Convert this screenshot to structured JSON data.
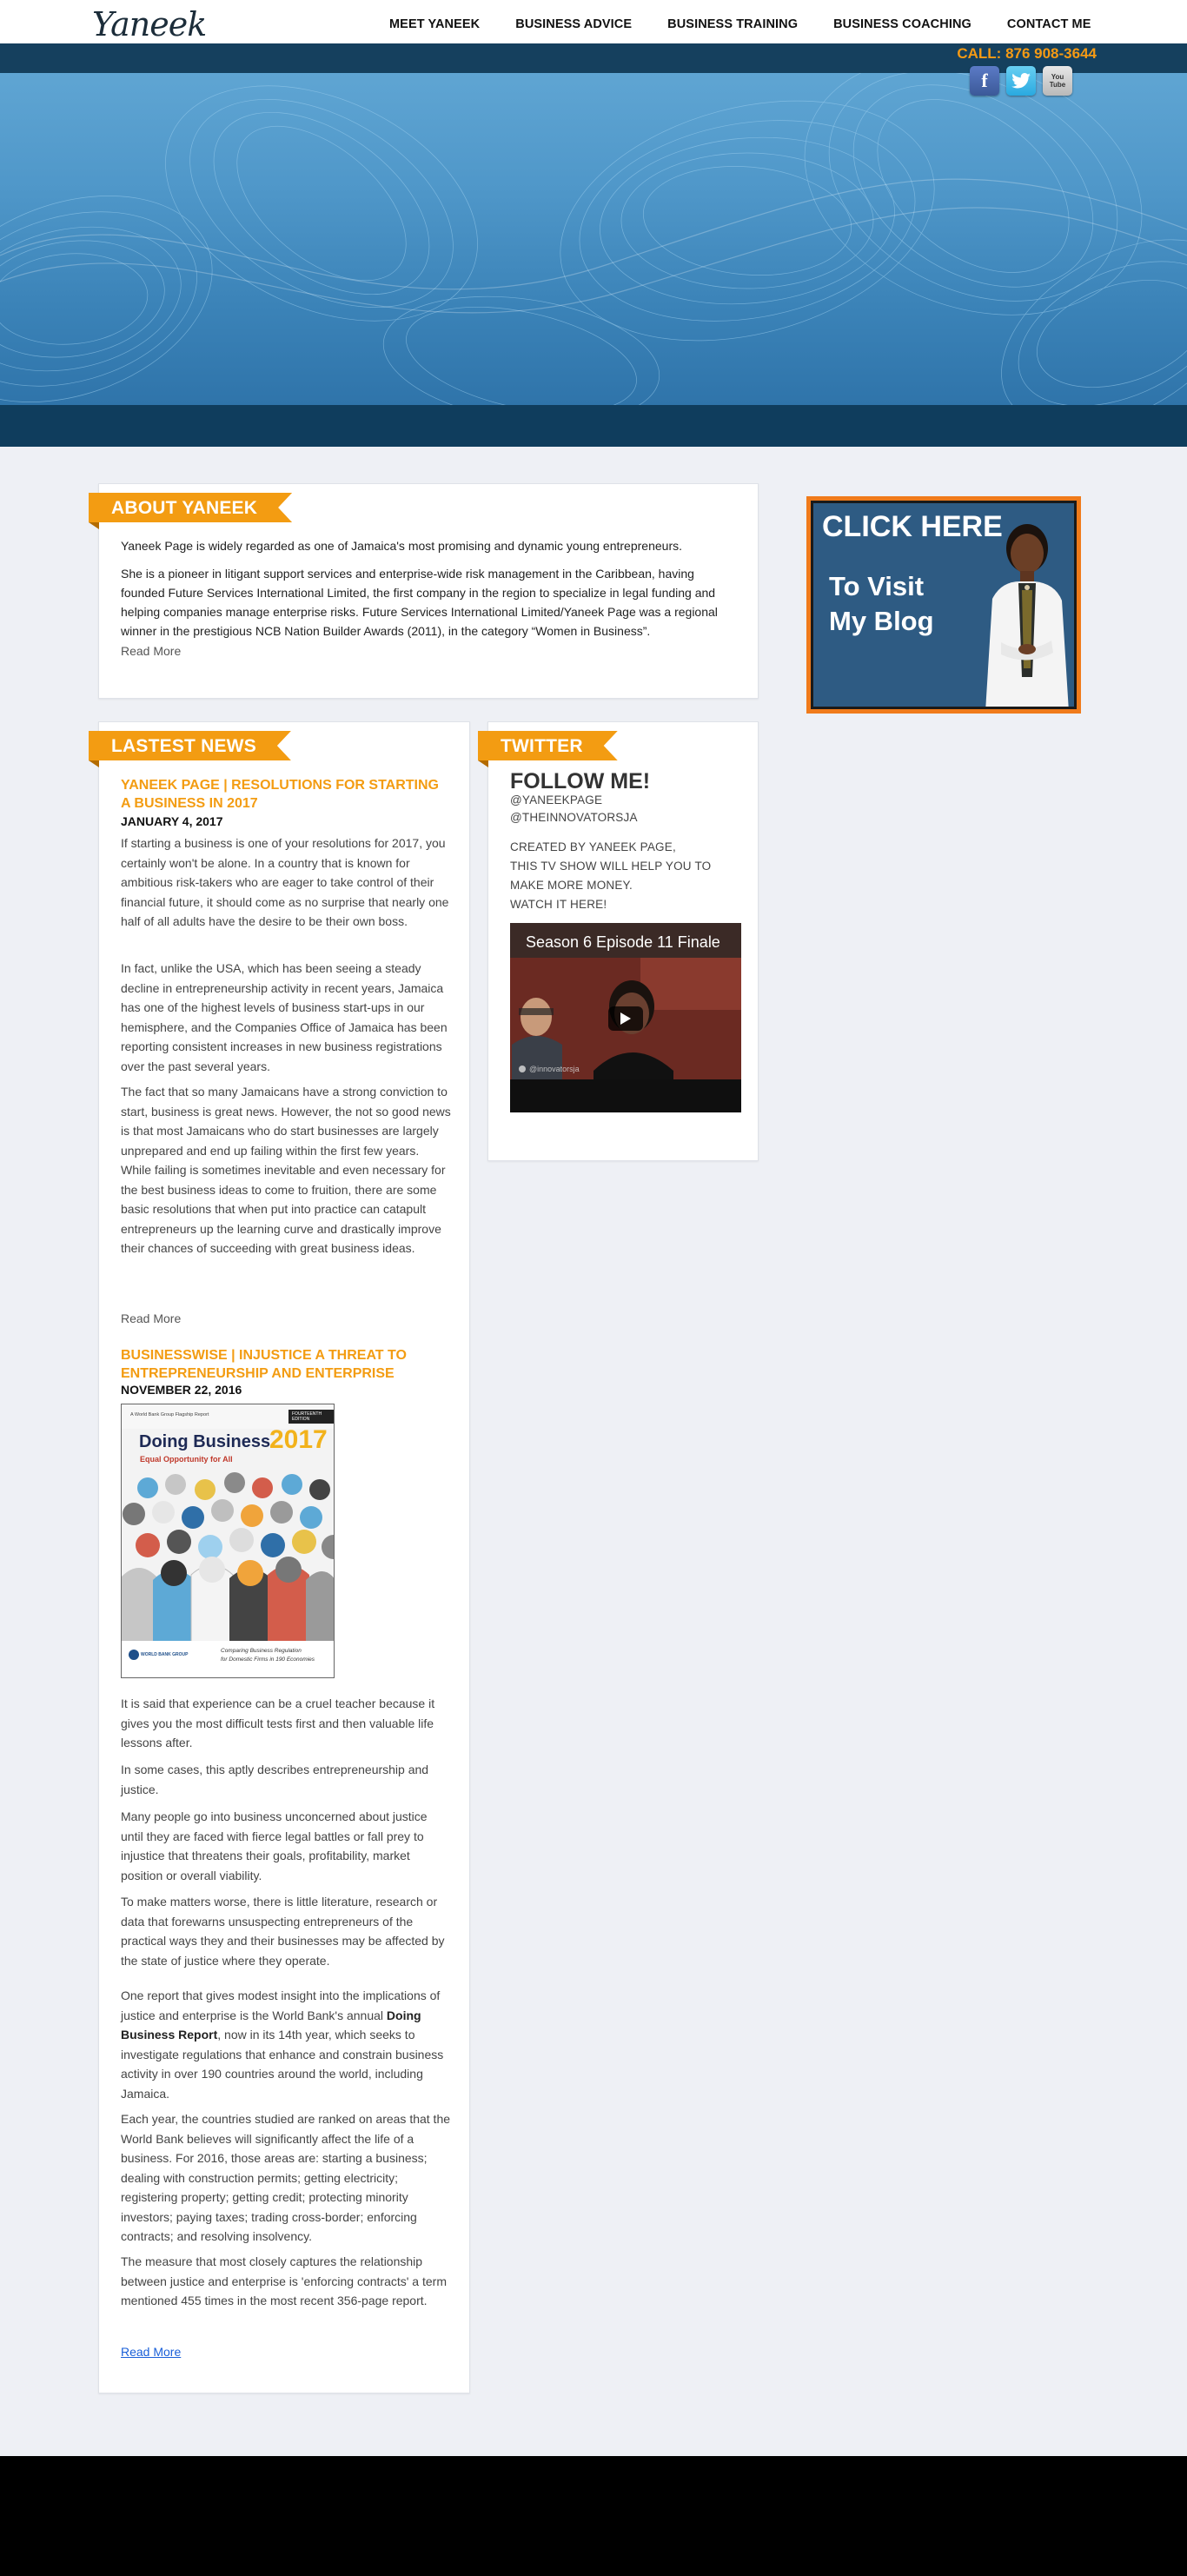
{
  "brand": {
    "logo_text": "Yaneek"
  },
  "nav": {
    "items": [
      {
        "label": "MEET YANEEK"
      },
      {
        "label": "BUSINESS ADVICE"
      },
      {
        "label": "BUSINESS TRAINING"
      },
      {
        "label": "BUSINESS COACHING"
      },
      {
        "label": "CONTACT ME"
      }
    ]
  },
  "header": {
    "call_text": "CALL: 876 908-3644",
    "social": [
      {
        "icon": "facebook-icon",
        "glyph": "f"
      },
      {
        "icon": "twitter-icon",
        "glyph": "t"
      },
      {
        "icon": "youtube-icon",
        "glyph": "You Tube"
      }
    ]
  },
  "about": {
    "ribbon": "ABOUT YANEEK",
    "para1": "Yaneek Page is widely regarded as one of Jamaica's most promising and dynamic young entrepreneurs.",
    "para2": "She is a pioneer in litigant support services and enterprise-wide risk management in the Caribbean, having founded Future Services International Limited, the first company in the region to specialize in legal funding and helping companies manage enterprise risks. Future Services International Limited/Yaneek Page was a regional winner in the prestigious NCB Nation Builder Awards (2011), in the category “Women in Business”.",
    "read_more": "Read More"
  },
  "blog_banner": {
    "line1": "CLICK HERE",
    "line2": "To Visit",
    "line3": "My Blog"
  },
  "news": {
    "ribbon": "LASTEST NEWS",
    "post1": {
      "title": "YANEEK PAGE | RESOLUTIONS FOR STARTING A BUSINESS IN 2017",
      "date": "JANUARY 4, 2017",
      "p1": "If starting a business is one of your resolutions for 2017, you certainly won't be alone. In a country that is known for ambitious risk-takers who are eager to take control of their financial future, it should come as no surprise that nearly one half of all adults have the desire to be their own boss.",
      "p2": "In fact, unlike the USA, which has been seeing a steady decline in entrepreneurship activity in recent years, Jamaica has one of the highest levels of business start-ups in our hemisphere, and the Companies Office of Jamaica has been reporting consistent increases in new business registrations over the past several years.",
      "p3": "The fact that so many Jamaicans have a strong conviction to start, business is great news. However, the not so good news is that most Jamaicans who do start businesses are largely unprepared and end up failing within the first few years. While failing is sometimes inevitable and even necessary for the best business ideas to come to fruition, there are some basic resolutions that when put into practice can catapult entrepreneurs up the learning curve and drastically improve their chances of succeeding with great business ideas.",
      "read_more": "Read More"
    },
    "post2": {
      "title": "BUSINESSWISE | INJUSTICE A THREAT TO ENTREPRENEURSHIP AND ENTERPRISE",
      "date": "NOVEMBER 22, 2016",
      "report": {
        "top": "A World Bank Group Flagship Report",
        "badge": "FOURTEENTH EDITION",
        "title": "Doing Business",
        "year": "2017",
        "subtitle": "Equal Opportunity for All",
        "foot1": "Comparing Business Regulation",
        "foot2": "for Domestic Firms in 190 Economies",
        "publisher": "WORLD BANK GROUP"
      },
      "p1": "It is said that experience can be a cruel teacher because it gives you the most difficult tests first and then valuable life lessons after.",
      "p2": "In some cases, this aptly describes entrepreneurship and justice.",
      "p3": "Many people go into business unconcerned about justice until they are faced with fierce legal battles or fall prey to injustice that threatens their goals, profitability, market position or overall viability.",
      "p4": "To make matters worse, there is little literature, research or data that forewarns unsuspecting entrepreneurs of the practical ways they and their businesses may be affected by the state of justice where they operate.",
      "p5a": "One report that gives modest insight into the implications of justice and enterprise is the World Bank's annual ",
      "p5b": "Doing Business Report",
      "p5c": ", now in its 14th year, which seeks to investigate regulations that enhance and constrain business activity in over 190 countries around the world, including Jamaica.",
      "p6": "Each year, the countries studied are ranked on areas that the World Bank believes will significantly affect the life of a business. For 2016, those areas are: starting a business; dealing with construction permits; getting electricity; registering property; getting credit; protecting minority investors; paying taxes; trading cross-border; enforcing contracts; and resolving insolvency.",
      "p7": "The measure that most closely captures the relationship between justice and enterprise is 'enforcing contracts' a term mentioned 455 times in the most recent 356-page report.",
      "read_more": "Read More "
    }
  },
  "twitter": {
    "ribbon": "TWITTER",
    "follow": "FOLLOW ME!",
    "handle1": "@YANEEKPAGE",
    "handle2": "@THEINNOVATORSJA",
    "promo1": "CREATED BY YANEEK PAGE,",
    "promo2": "THIS TV SHOW WILL HELP YOU TO",
    "promo3": "MAKE MORE MONEY.",
    "promo4": "WATCH IT HERE!",
    "video_title": "Season 6 Episode 11 Finale",
    "video_watermark": "@innovatorsja"
  },
  "colors": {
    "accent": "#f39c12",
    "nav_bg": "#ffffff",
    "hero_dark": "#0e3a5a",
    "page_bg": "#eef0f5",
    "footer_bg": "#000000"
  }
}
